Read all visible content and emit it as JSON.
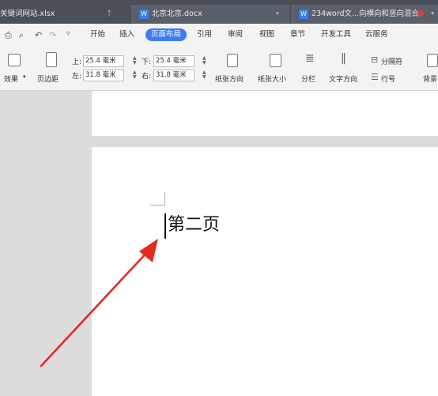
{
  "tabs": [
    {
      "label": "关键词网站.xlsx"
    },
    {
      "label": "北京北京.docx"
    },
    {
      "label": "234word文...向横向和竖向混合"
    }
  ],
  "menu": [
    "开始",
    "插入",
    "页面布局",
    "引用",
    "审阅",
    "视图",
    "章节",
    "开发工具",
    "云服务"
  ],
  "ribbon": {
    "effects_label": "效果",
    "margin_label": "页边距",
    "top_label": "上:",
    "top_value": "25.4 毫米",
    "bottom_label": "下:",
    "bottom_value": "25.4 毫米",
    "left_label": "左:",
    "left_value": "31.8 毫米",
    "right_label": "右:",
    "right_value": "31.8 毫米",
    "orientation_label": "纸张方向",
    "size_label": "纸张大小",
    "columns_label": "分栏",
    "text_direction_label": "文字方向",
    "separator_label": "分隔符",
    "line_number_label": "行号",
    "background_label": "背景"
  },
  "document": {
    "page2_text": "第二页"
  },
  "colors": {
    "accent": "#3b7cf5",
    "arrow": "#e8291c",
    "tabbar": "#4a4f58"
  }
}
